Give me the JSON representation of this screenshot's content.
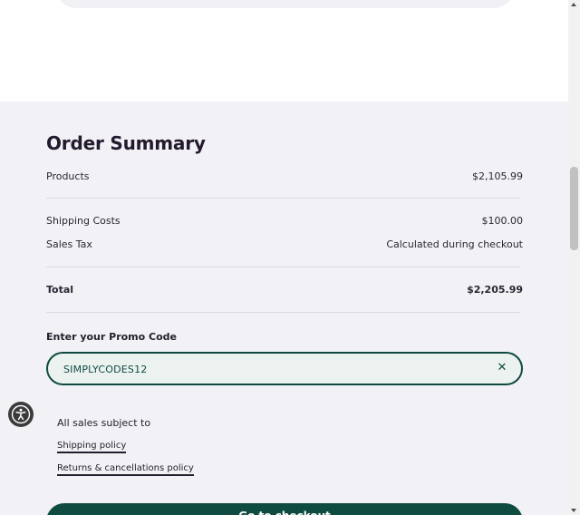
{
  "order_summary": {
    "title": "Order Summary",
    "products": {
      "label": "Products",
      "value": "$2,105.99"
    },
    "shipping": {
      "label": "Shipping Costs",
      "value": "$100.00"
    },
    "sales_tax": {
      "label": "Sales Tax",
      "value": "Calculated during checkout"
    },
    "total": {
      "label": "Total",
      "value": "$2,205.99"
    }
  },
  "promo": {
    "label": "Enter your Promo Code",
    "value": "SIMPLYCODES12",
    "clear_glyph": "✕"
  },
  "policies": {
    "intro": "All sales subject to",
    "shipping_link": "Shipping policy",
    "returns_link": "Returns & cancellations policy"
  },
  "checkout": {
    "label": "Go to checkout"
  },
  "icons": {
    "accessibility": "accessibility-icon",
    "clear": "close-icon"
  },
  "colors": {
    "accent": "#0f4b41",
    "summary_bg": "#f2f1f5",
    "text": "#231f2c"
  }
}
